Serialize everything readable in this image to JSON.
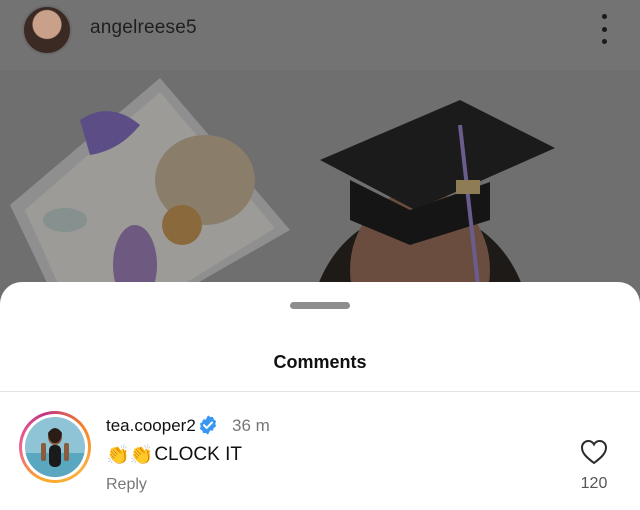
{
  "post": {
    "username": "angelreese5",
    "more_icon": "more-vertical-icon"
  },
  "sheet": {
    "title": "Comments"
  },
  "comment": {
    "username": "tea.cooper2",
    "verified_icon": "verified-badge-icon",
    "time": "36 m",
    "emoji": "👏👏",
    "text": "CLOCK IT",
    "reply_label": "Reply",
    "like_icon": "heart-outline-icon",
    "like_count": "120"
  },
  "colors": {
    "verified_blue": "#3897f0",
    "dim_overlay": "#737373",
    "sheet_bg": "#ffffff"
  }
}
